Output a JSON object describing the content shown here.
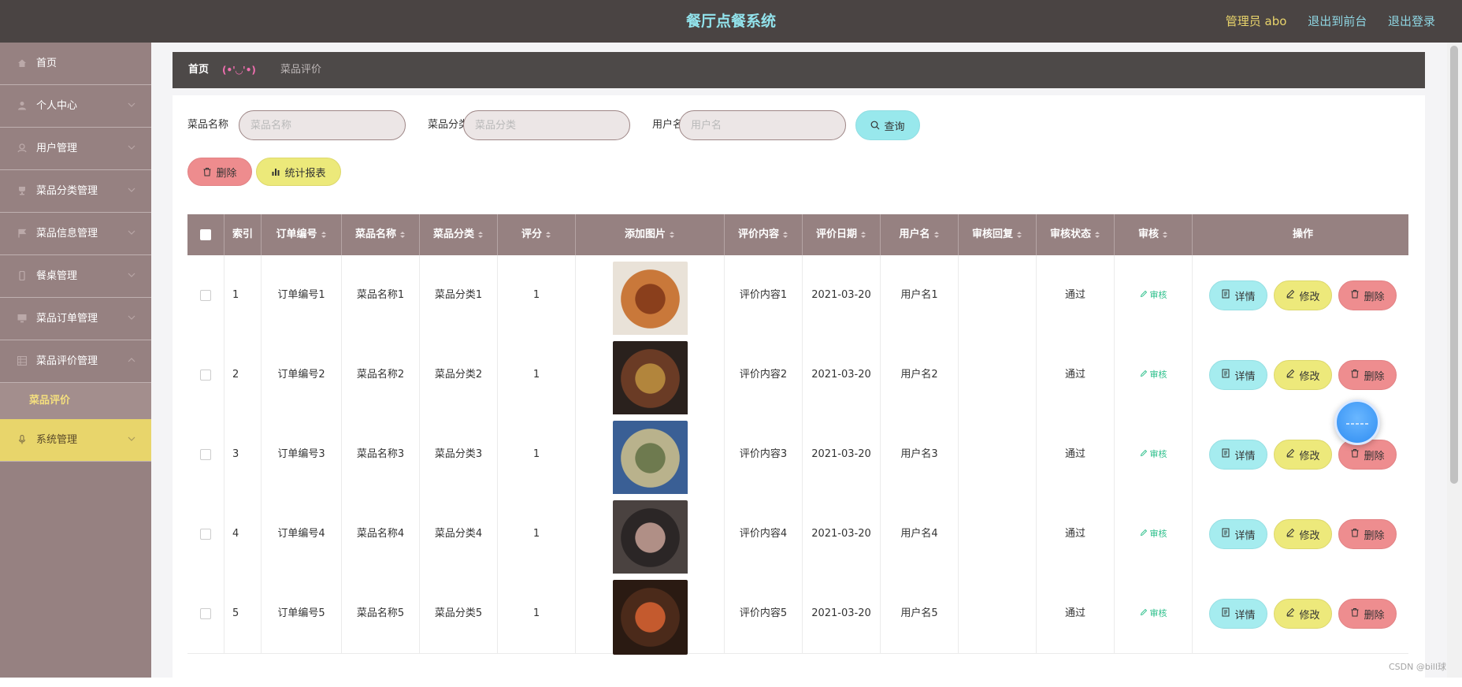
{
  "header": {
    "title": "餐厅点餐系统",
    "admin": "管理员 abo",
    "to_front": "退出到前台",
    "logout": "退出登录"
  },
  "sidebar": {
    "items": [
      {
        "label": "首页",
        "icon": "home-icon"
      },
      {
        "label": "个人中心",
        "icon": "user-icon"
      },
      {
        "label": "用户管理",
        "icon": "users-icon"
      },
      {
        "label": "菜品分类管理",
        "icon": "trophy-icon"
      },
      {
        "label": "菜品信息管理",
        "icon": "flag-icon"
      },
      {
        "label": "餐桌管理",
        "icon": "phone-icon"
      },
      {
        "label": "菜品订单管理",
        "icon": "monitor-icon"
      },
      {
        "label": "菜品评价管理",
        "icon": "grid-icon"
      }
    ],
    "sub_item": "菜品评价",
    "system": "系统管理"
  },
  "breadcrumb": {
    "home": "首页",
    "sep": "(•'◡'•)",
    "current": "菜品评价"
  },
  "search": {
    "name_label": "菜品名称",
    "name_placeholder": "菜品名称",
    "category_label": "菜品分类",
    "category_placeholder": "菜品分类",
    "user_label": "用户名",
    "user_placeholder": "用户名",
    "query": "查询"
  },
  "toolbar": {
    "delete": "删除",
    "report": "统计报表"
  },
  "table": {
    "columns": [
      "索引",
      "订单编号",
      "菜品名称",
      "菜品分类",
      "评分",
      "添加图片",
      "评价内容",
      "评价日期",
      "用户名",
      "审核回复",
      "审核状态",
      "审核",
      "操作"
    ],
    "rows": [
      {
        "index": "1",
        "order": "订单编号1",
        "dish": "菜品名称1",
        "category": "菜品分类1",
        "score": "1",
        "content": "评价内容1",
        "date": "2021-03-20",
        "user": "用户名1",
        "reply": "",
        "status": "通过",
        "image": "food-photo-1"
      },
      {
        "index": "2",
        "order": "订单编号2",
        "dish": "菜品名称2",
        "category": "菜品分类2",
        "score": "1",
        "content": "评价内容2",
        "date": "2021-03-20",
        "user": "用户名2",
        "reply": "",
        "status": "通过",
        "image": "food-photo-2"
      },
      {
        "index": "3",
        "order": "订单编号3",
        "dish": "菜品名称3",
        "category": "菜品分类3",
        "score": "1",
        "content": "评价内容3",
        "date": "2021-03-20",
        "user": "用户名3",
        "reply": "",
        "status": "通过",
        "image": "food-photo-3"
      },
      {
        "index": "4",
        "order": "订单编号4",
        "dish": "菜品名称4",
        "category": "菜品分类4",
        "score": "1",
        "content": "评价内容4",
        "date": "2021-03-20",
        "user": "用户名4",
        "reply": "",
        "status": "通过",
        "image": "food-photo-4"
      },
      {
        "index": "5",
        "order": "订单编号5",
        "dish": "菜品名称5",
        "category": "菜品分类5",
        "score": "1",
        "content": "评价内容5",
        "date": "2021-03-20",
        "user": "用户名5",
        "reply": "",
        "status": "通过",
        "image": "food-photo-5"
      }
    ],
    "audit_label": "审核",
    "detail_label": "详情",
    "edit_label": "修改",
    "delete_label": "删除"
  },
  "watermark": "CSDN @bill球",
  "colors": {
    "header_bg": "#4a4443",
    "title": "#92e3ec",
    "sidebar_bg": "#968181",
    "sidebar_active": "#e8d56b",
    "query_btn": "#98e8ec",
    "delete_btn": "#ee8c8e",
    "edit_btn": "#ece97a"
  }
}
